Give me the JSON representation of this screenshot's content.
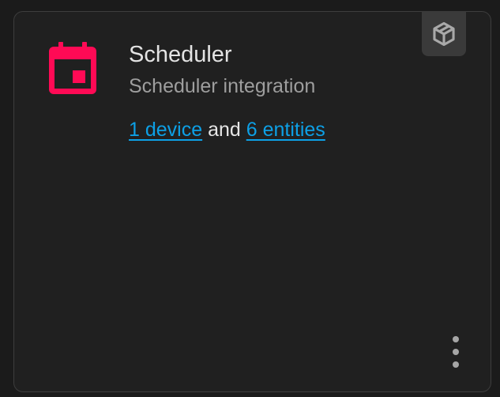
{
  "integration": {
    "title": "Scheduler",
    "subtitle": "Scheduler integration",
    "device_link": "1 device",
    "conjunction": " and ",
    "entities_link": "6 entities",
    "icon": "calendar-icon",
    "badge_icon": "custom-integration-cube-icon",
    "menu_icon": "dots-vertical-icon"
  },
  "colors": {
    "icon_accent": "#ff0a55",
    "link": "#0da0e6",
    "card_bg": "#202020",
    "page_bg": "#1b1b1b"
  }
}
